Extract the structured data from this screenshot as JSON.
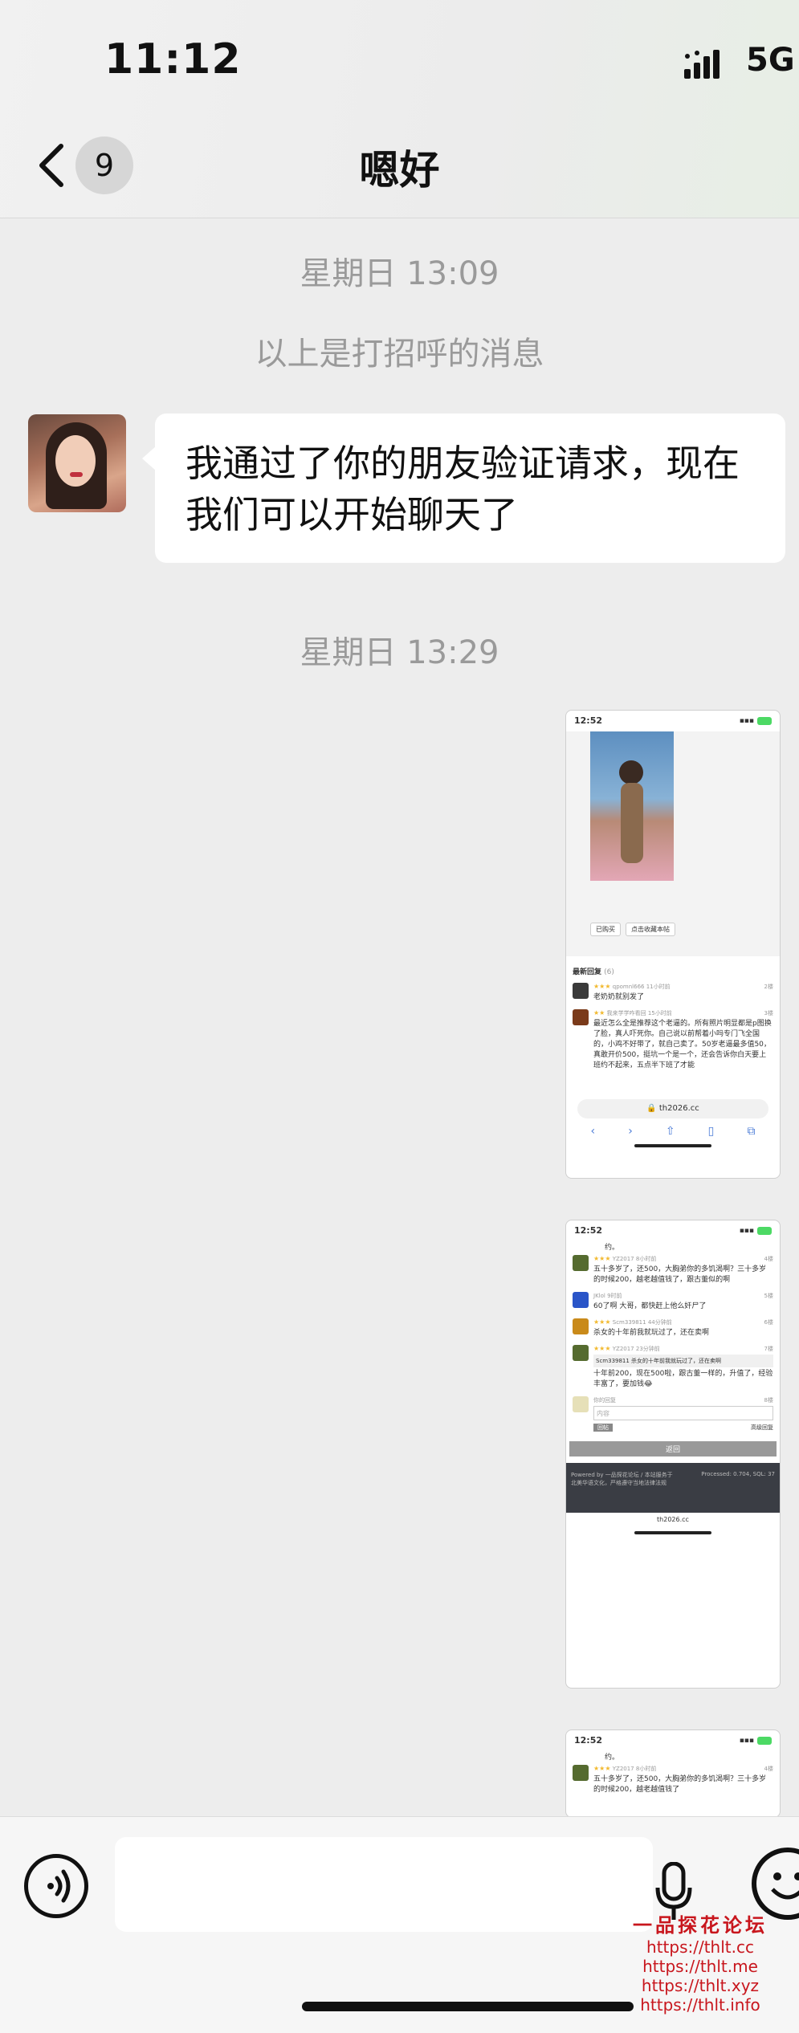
{
  "status_bar": {
    "time": "11:12",
    "network": "5G"
  },
  "header": {
    "unread_count": "9",
    "title": "嗯好"
  },
  "messages": {
    "timestamp_1": "星期日 13:09",
    "system_notice": "以上是打招呼的消息",
    "incoming_text": "我通过了你的朋友验证请求，现在我们可以开始聊天了",
    "timestamp_2": "星期日 13:29"
  },
  "screenshot_1": {
    "time": "12:52",
    "buttons": [
      "已购买",
      "点击收藏本帖"
    ],
    "section_title": "最新回复",
    "section_count": "(6)",
    "replies": [
      {
        "user": "qpomnl666",
        "time": "11小时前",
        "floor": "2楼",
        "text": "老奶奶就别发了"
      },
      {
        "user": "我来学学咋看回",
        "time": "15小时前",
        "floor": "3楼",
        "text": "最近怎么全是推荐这个老逼的。所有照片明显都是p图换了脸，真人吓死你。自己说以前帮着小吗专门飞全国的，小鸡不好带了，就自己卖了。50岁老逼最多值50，真敢开价500，挺坑一个是一个，还会告诉你白天要上班约不起来，五点半下班了才能"
      }
    ],
    "url": "th2026.cc"
  },
  "screenshot_2": {
    "time": "12:52",
    "top_text": "约。",
    "replies": [
      {
        "user": "YZ2017",
        "time": "8小时前",
        "floor": "4楼",
        "text": "五十多岁了，还500，大胸弟你的多饥渴啊？三十多岁的时候200，越老越值钱了，跟古董似的啊"
      },
      {
        "user": "JKlol",
        "time": "9时前",
        "floor": "5楼",
        "text": "60了啊 大哥，都快赶上他么奸尸了"
      },
      {
        "user": "Scm339811",
        "time": "44分钟前",
        "floor": "6楼",
        "text": "杀女的十年前我就玩过了，还在卖啊"
      },
      {
        "user": "YZ2017",
        "time": "23分钟前",
        "floor": "7楼",
        "quote": "Scm339811 杀女的十年前我就玩过了，还在卖啊",
        "text": "十年前200，现在500啦，跟古董一样的，升值了，经验丰富了，要加钱😂"
      }
    ],
    "reply_form": {
      "label": "你的回复",
      "floor": "8楼",
      "placeholder": "内容",
      "submit": "回帖",
      "advanced": "高级回复"
    },
    "back_button": "返回",
    "footer_left": "Powered by 一品探花论坛 / 本站服务于北美华语文化，严格遵守当地法律法规",
    "footer_right": "Processed: 0.704, SQL: 37",
    "footer_url": "th2026.cc"
  },
  "screenshot_3": {
    "time": "12:52",
    "top_text": "约。",
    "reply": {
      "user": "YZ2017",
      "time": "8小时前",
      "floor": "4楼",
      "text": "五十多岁了，还500，大胸弟你的多饥渴啊？三十多岁的时候200，越老越值钱了"
    }
  },
  "watermark": {
    "title": "一品探花论坛",
    "links": [
      "https://thlt.cc",
      "https://thlt.me",
      "https://thlt.xyz",
      "https://thlt.info"
    ]
  },
  "colors": {
    "background": "#ededed",
    "bubble": "#ffffff",
    "watermark": "#c8161d",
    "timestamp": "#9a9a9a"
  }
}
